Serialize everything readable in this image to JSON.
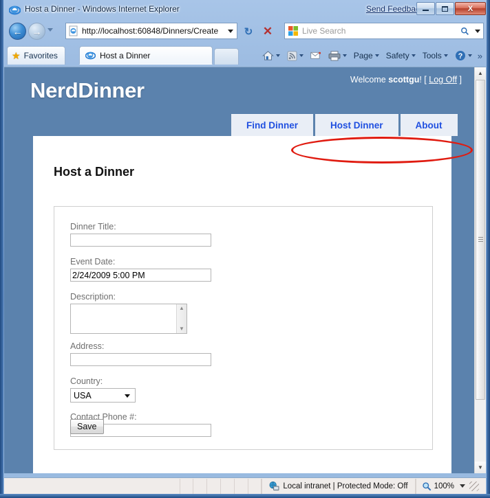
{
  "window": {
    "title": "Host a Dinner - Windows Internet Explorer",
    "send_feedback": "Send Feedback",
    "minimize_label": "Minimize",
    "maximize_label": "Maximize",
    "close_label": "X"
  },
  "navbar": {
    "back_glyph": "←",
    "forward_glyph": "→",
    "url": "http://localhost:60848/Dinners/Create",
    "refresh_glyph": "↻",
    "stop_glyph": "✕",
    "search_placeholder": "Live Search",
    "search_magnifier": "⚲"
  },
  "tabrow": {
    "favorites_label": "Favorites",
    "tab_label": "Host a Dinner",
    "commands": [
      {
        "name": "home",
        "label": ""
      },
      {
        "name": "feeds",
        "label": ""
      },
      {
        "name": "mail",
        "label": ""
      },
      {
        "name": "print",
        "label": ""
      },
      {
        "name": "page",
        "label": "Page"
      },
      {
        "name": "safety",
        "label": "Safety"
      },
      {
        "name": "tools",
        "label": "Tools"
      },
      {
        "name": "help",
        "label": ""
      }
    ],
    "overflow_glyph": "»"
  },
  "page": {
    "logo": "NerdDinner",
    "welcome_prefix": "Welcome ",
    "welcome_user": "scottgu",
    "welcome_suffix": "! [ ",
    "logoff_label": "Log Off",
    "welcome_end": " ]",
    "nav_tabs": [
      {
        "label": "Find Dinner"
      },
      {
        "label": "Host Dinner"
      },
      {
        "label": "About"
      }
    ],
    "heading": "Host a Dinner",
    "fields": [
      {
        "label": "Dinner Title:",
        "value": "",
        "type": "text"
      },
      {
        "label": "Event Date:",
        "value": "2/24/2009 5:00 PM",
        "type": "text"
      },
      {
        "label": "Description:",
        "value": "",
        "type": "textarea"
      },
      {
        "label": "Address:",
        "value": "",
        "type": "text"
      },
      {
        "label": "Country:",
        "value": "USA",
        "type": "select"
      },
      {
        "label": "Contact Phone #:",
        "value": "",
        "type": "text"
      }
    ],
    "save_label": "Save",
    "scroll_up_glyph": "▲",
    "scroll_down_glyph": "▼",
    "annotation_color": "#e01b10",
    "background_color": "#5b82ad",
    "link_color": "#1f4fe0"
  },
  "statusbar": {
    "zone_text": "Local intranet | Protected Mode: Off",
    "zoom_level": "100%",
    "zoom_caret": "▼"
  }
}
